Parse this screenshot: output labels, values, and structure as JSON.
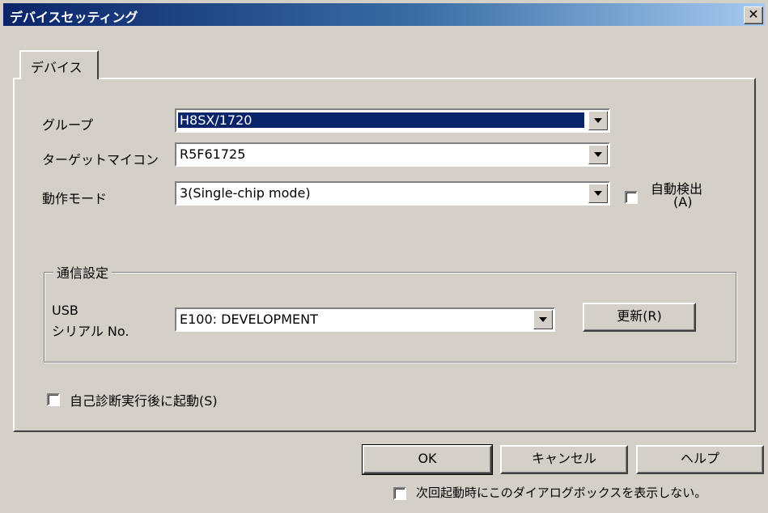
{
  "window": {
    "title": "デバイスセッティング",
    "close_label": "✕"
  },
  "tab": {
    "label": "デバイス"
  },
  "fields": {
    "group_label": "グループ",
    "group_value": "H8SX/1720",
    "target_label": "ターゲットマイコン",
    "target_value": "R5F61725",
    "mode_label": "動作モード",
    "mode_value": "3(Single-chip mode)"
  },
  "auto_detect": {
    "label_line1": "自動検出",
    "label_line2": "(A)",
    "checked": false
  },
  "comm": {
    "section_title": "通信設定",
    "usb_label_line1": "USB",
    "usb_label_line2": "シリアル No.",
    "usb_value": "E100: DEVELOPMENT",
    "refresh_label": "更新(R)"
  },
  "self_diag": {
    "label": "自己診断実行後に起動(S)",
    "checked": false
  },
  "buttons": {
    "ok": "OK",
    "cancel": "キャンセル",
    "help": "ヘルプ"
  },
  "dont_show": {
    "label": "次回起動時にこのダイアログボックスを表示しない。",
    "checked": false
  },
  "colors": {
    "face": "#d4d0c8",
    "title_start": "#0a246a",
    "title_end": "#a6caf0",
    "selection": "#0a246a"
  },
  "icons": {
    "close": "close-icon",
    "dropdown": "chevron-down-icon"
  }
}
